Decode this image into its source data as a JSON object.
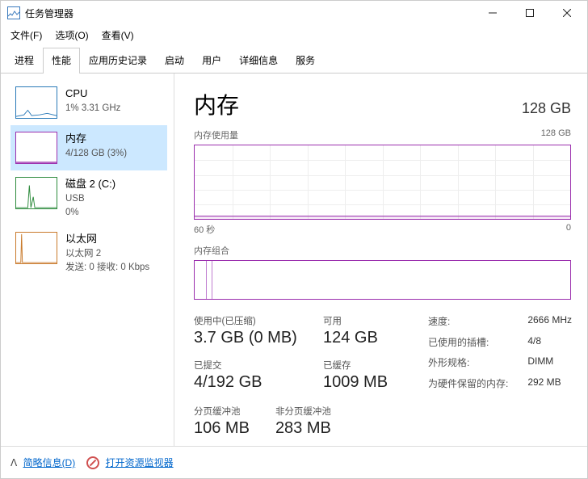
{
  "window": {
    "title": "任务管理器"
  },
  "menu": {
    "file": "文件(F)",
    "options": "选项(O)",
    "view": "查看(V)"
  },
  "tabs": {
    "processes": "进程",
    "performance": "性能",
    "history": "应用历史记录",
    "startup": "启动",
    "users": "用户",
    "details": "详细信息",
    "services": "服务"
  },
  "sidebar": {
    "items": [
      {
        "name": "CPU",
        "sub": "1% 3.31 GHz",
        "color": "#2a7ab8"
      },
      {
        "name": "内存",
        "sub": "4/128 GB (3%)",
        "color": "#9b2fae",
        "selected": true
      },
      {
        "name": "磁盘 2 (C:)",
        "sub1": "USB",
        "sub2": "0%",
        "color": "#2e8b3d"
      },
      {
        "name": "以太网",
        "sub1": "以太网 2",
        "sub2": "发送: 0 接收: 0 Kbps",
        "color": "#c97a2b"
      }
    ]
  },
  "main": {
    "title": "内存",
    "total": "128 GB",
    "usage_label": "内存使用量",
    "usage_max": "128 GB",
    "axis_left": "60 秒",
    "axis_right": "0",
    "composition_label": "内存组合",
    "stats": {
      "in_use_label": "使用中(已压缩)",
      "in_use_value": "3.7 GB (0 MB)",
      "available_label": "可用",
      "available_value": "124 GB",
      "committed_label": "已提交",
      "committed_value": "4/192 GB",
      "cached_label": "已缓存",
      "cached_value": "1009 MB",
      "paged_label": "分页缓冲池",
      "paged_value": "106 MB",
      "nonpaged_label": "非分页缓冲池",
      "nonpaged_value": "283 MB"
    },
    "kv": {
      "speed_label": "速度:",
      "speed_value": "2666 MHz",
      "slots_label": "已使用的插槽:",
      "slots_value": "4/8",
      "form_label": "外形规格:",
      "form_value": "DIMM",
      "hw_label": "为硬件保留的内存:",
      "hw_value": "292 MB"
    }
  },
  "footer": {
    "fewer": "简略信息(D)",
    "resmon": "打开资源监视器"
  }
}
